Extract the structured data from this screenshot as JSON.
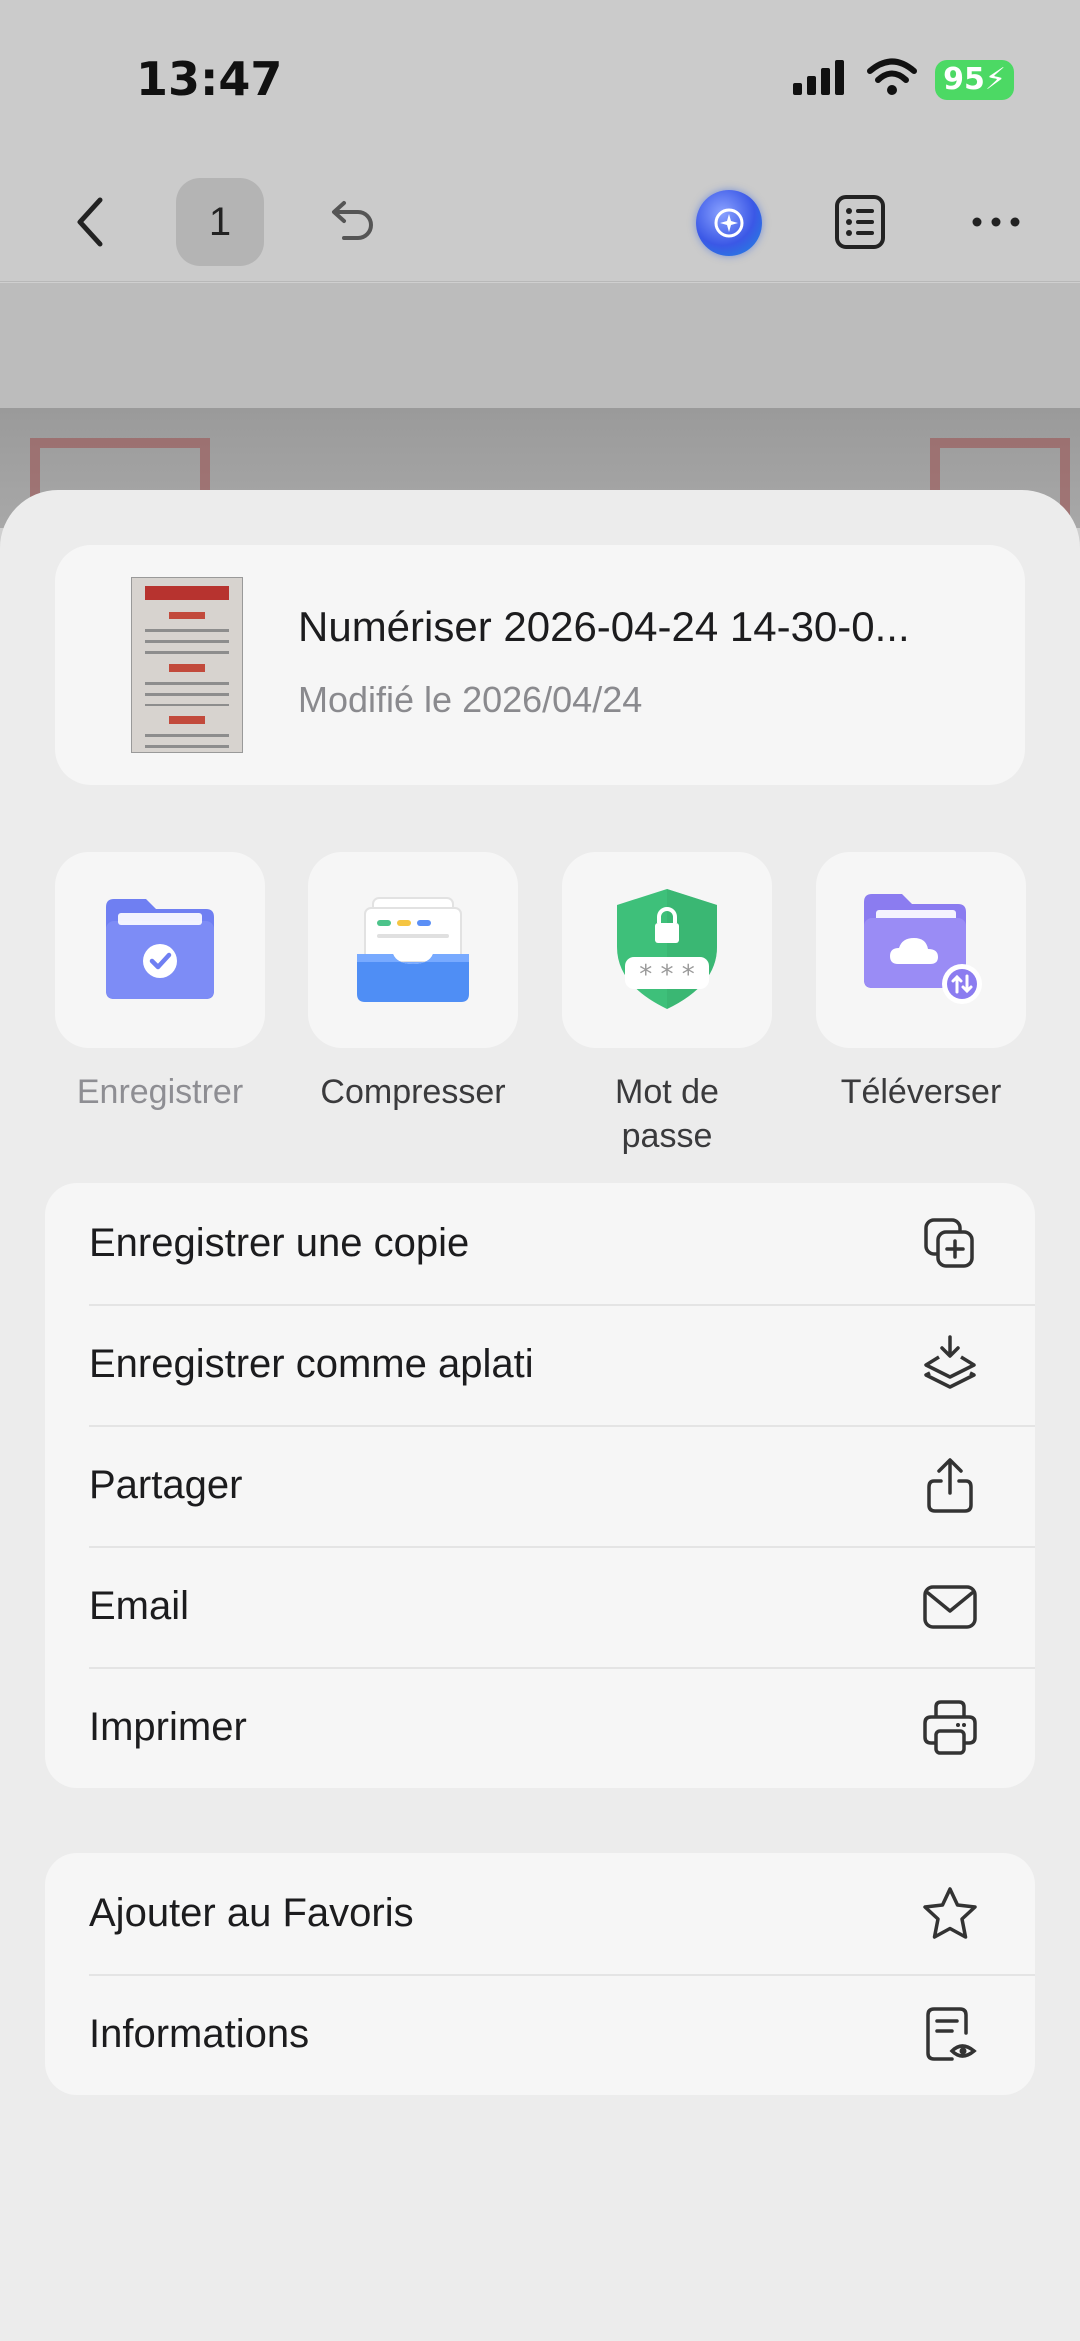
{
  "status_bar": {
    "time": "13:47",
    "battery": "95"
  },
  "toolbar": {
    "page_number": "1"
  },
  "file": {
    "name": "Numériser 2026-04-24 14-30-0...",
    "modified": "Modifié le 2026/04/24"
  },
  "quick_actions": [
    {
      "label": "Enregistrer",
      "icon": "folder-check-icon"
    },
    {
      "label": "Compresser",
      "icon": "tray-compress-icon"
    },
    {
      "label": "Mot de passe",
      "icon": "shield-lock-icon"
    },
    {
      "label": "Téléverser",
      "icon": "cloud-folder-icon"
    }
  ],
  "menu_group_1": [
    {
      "label": "Enregistrer une copie",
      "icon": "copy-plus-icon"
    },
    {
      "label": "Enregistrer comme aplati",
      "icon": "flatten-download-icon"
    },
    {
      "label": "Partager",
      "icon": "share-icon"
    },
    {
      "label": "Email",
      "icon": "mail-icon"
    },
    {
      "label": "Imprimer",
      "icon": "printer-icon"
    }
  ],
  "menu_group_2": [
    {
      "label": "Ajouter au Favoris",
      "icon": "star-icon"
    },
    {
      "label": "Informations",
      "icon": "doc-info-icon"
    }
  ],
  "colors": {
    "save_folder": "#6f7ff2",
    "compress_tray": "#4f8ef5",
    "password_shield": "#3ec07a",
    "upload_folder": "#8b7cf0",
    "battery": "#4cd964"
  }
}
